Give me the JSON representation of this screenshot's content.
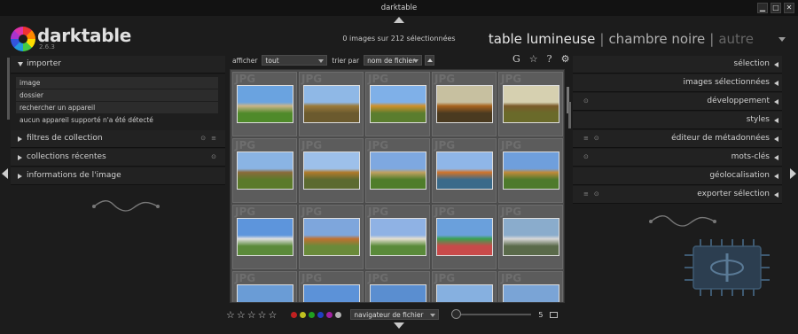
{
  "window": {
    "title": "darktable",
    "min": "▁",
    "max": "□",
    "close": "✕"
  },
  "header": {
    "app_name": "darktable",
    "version": "2.6.3",
    "selection_info": "0 images sur 212 sélectionnées",
    "views": {
      "active": "table lumineuse",
      "second": "chambre noire",
      "third": "autre",
      "separator": "|"
    }
  },
  "left_panel": {
    "importer": {
      "label": "importer",
      "items": [
        "image",
        "dossier",
        "rechercher un appareil",
        "aucun appareil supporté n'a été détecté"
      ]
    },
    "modules": [
      {
        "label": "filtres de collection",
        "icons": [
          "⊙",
          "≡"
        ]
      },
      {
        "label": "collections récentes",
        "icons": [
          "⊙"
        ]
      },
      {
        "label": "informations de l'image",
        "icons": []
      }
    ]
  },
  "filter_bar": {
    "show_label": "afficher",
    "show_value": "tout",
    "sort_label": "trier par",
    "sort_value": "nom de fichier"
  },
  "right_top_icons": [
    "G",
    "☆",
    "?",
    "⚙"
  ],
  "right_panel": {
    "modules": [
      {
        "label": "sélection",
        "icons": []
      },
      {
        "label": "images sélectionnées",
        "icons": []
      },
      {
        "label": "développement",
        "icons": [
          "⊙"
        ]
      },
      {
        "label": "styles",
        "icons": []
      },
      {
        "label": "éditeur de métadonnées",
        "icons": [
          "≡",
          "⊙"
        ]
      },
      {
        "label": "mots-clés",
        "icons": [
          "⊙"
        ]
      },
      {
        "label": "géolocalisation",
        "icons": []
      },
      {
        "label": "exporter sélection",
        "icons": [
          "≡",
          "⊙"
        ]
      }
    ]
  },
  "thumbnails": {
    "badge": "JPG",
    "items": [
      {
        "scene": "chateau-lawn",
        "sky": "#6aa3e0",
        "ground": "#4f8a2a",
        "accent": "#c9b48a"
      },
      {
        "scene": "pond-trees",
        "sky": "#8fb8e6",
        "ground": "#6b5a2e",
        "accent": "#9b7a3a"
      },
      {
        "scene": "avenue-autumn",
        "sky": "#7fb0e8",
        "ground": "#5a7d2e",
        "accent": "#d0902a"
      },
      {
        "scene": "forest-path",
        "sky": "#c7c0a0",
        "ground": "#4a3a20",
        "accent": "#a8631e"
      },
      {
        "scene": "park-alley",
        "sky": "#d6d0b0",
        "ground": "#6a6a2a",
        "accent": "#7a5a2a"
      },
      {
        "scene": "tree-row",
        "sky": "#8ab4e4",
        "ground": "#5b7a2a",
        "accent": "#8a6a3a"
      },
      {
        "scene": "path-trees",
        "sky": "#9dc0ea",
        "ground": "#5c6a30",
        "accent": "#b07a2a"
      },
      {
        "scene": "gate-lawn",
        "sky": "#7ea8e0",
        "ground": "#4f7d2a",
        "accent": "#c0a060"
      },
      {
        "scene": "lake-autumn",
        "sky": "#8fb6e8",
        "ground": "#3a6a8a",
        "accent": "#d0742a"
      },
      {
        "scene": "park-hills",
        "sky": "#6f9fdc",
        "ground": "#4e7a2c",
        "accent": "#c08a3a"
      },
      {
        "scene": "manor-blue",
        "sky": "#5d95dc",
        "ground": "#5b8a3a",
        "accent": "#e0e0e0"
      },
      {
        "scene": "chateau-autumn",
        "sky": "#7ea6dc",
        "ground": "#6a8a3a",
        "accent": "#c07030"
      },
      {
        "scene": "chateau-front",
        "sky": "#8fb2e4",
        "ground": "#5a8a3a",
        "accent": "#e6e0d0"
      },
      {
        "scene": "mural",
        "sky": "#6aa0dc",
        "ground": "#c84a4a",
        "accent": "#3aa050"
      },
      {
        "scene": "town-houses",
        "sky": "#8aaccc",
        "ground": "#5a6a4a",
        "accent": "#d8d8d8"
      },
      {
        "scene": "building-blue",
        "sky": "#6a9cd6",
        "ground": "#8a7060",
        "accent": "#e8d8b8"
      },
      {
        "scene": "sky-roof",
        "sky": "#5c92d8",
        "ground": "#7a6a5a",
        "accent": "#e0e0e0"
      },
      {
        "scene": "classical-facade",
        "sky": "#5a8ed0",
        "ground": "#9a8a7a",
        "accent": "#f0e8d8"
      },
      {
        "scene": "street-sky",
        "sky": "#86b0e0",
        "ground": "#7a7a7a",
        "accent": "#c8c8c8"
      },
      {
        "scene": "city-view",
        "sky": "#7aa4d6",
        "ground": "#6a5a4a",
        "accent": "#d8c8a8"
      }
    ]
  },
  "bottom_bar": {
    "stars": [
      "☆",
      "☆",
      "☆",
      "☆",
      "☆"
    ],
    "color_labels": [
      "#c02020",
      "#c0c020",
      "#20a020",
      "#2040c0",
      "#a020a0",
      "#b0b0b0"
    ],
    "navigator": "navigateur de fichier",
    "zoom": "5"
  }
}
